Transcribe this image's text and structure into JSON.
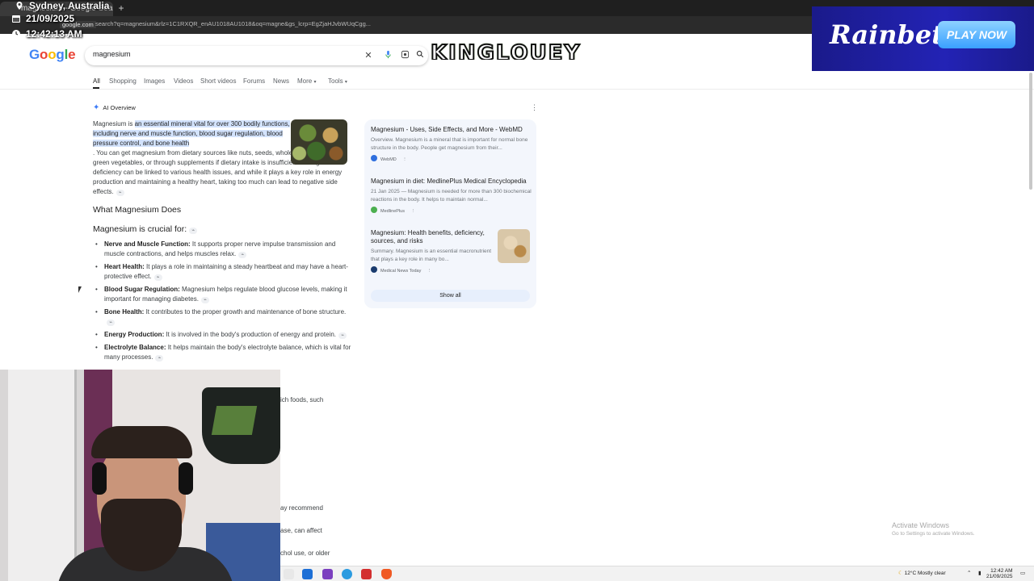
{
  "browser": {
    "tab_title": "magnesium - Google Search",
    "new_tab_glyph": "+",
    "url_tooltip": "google.com",
    "url": "search?q=magnesium&rlz=1C1RXQR_enAU1018AU1018&oq=magne&gs_lcrp=EgZjaHJvbWUqCgg..."
  },
  "stream_overlay": {
    "location": "Sydney, Australia",
    "date": "21/09/2025",
    "time": "12:42:13 AM"
  },
  "promo": {
    "brand": "Rainbet",
    "cta": "PLAY NOW"
  },
  "banner": {
    "text": "KINGLOUEY"
  },
  "google": {
    "logo_letters": [
      "G",
      "o",
      "o",
      "g",
      "l",
      "e"
    ],
    "logo_colors": [
      "#4285F4",
      "#EA4335",
      "#FBBC05",
      "#4285F4",
      "#34A853",
      "#EA4335"
    ],
    "query": "magnesium",
    "tabs": [
      "All",
      "Shopping",
      "Images",
      "Videos",
      "Short videos",
      "Forums",
      "News",
      "More",
      "Tools"
    ]
  },
  "ai_overview": {
    "label": "AI Overview",
    "intro_plain": "Magnesium is ",
    "intro_highlight": "an essential mineral vital for over 300 bodily functions, including nerve and muscle function, blood sugar regulation, blood pressure control, and bone health",
    "intro_rest": ". You can get magnesium from dietary sources like nuts, seeds, whole grains, and leafy green vegetables, or through supplements if dietary intake is insufficient. A magnesium deficiency can be linked to various health issues, and while it plays a key role in energy production and maintaining a healthy heart, taking too much can lead to negative side effects.",
    "heading": "What Magnesium Does",
    "subheading": "Magnesium is crucial for:",
    "bullets": [
      {
        "title": "Nerve and Muscle Function:",
        "text": " It supports proper nerve impulse transmission and muscle contractions, and helps muscles relax."
      },
      {
        "title": "Heart Health:",
        "text": " It plays a role in maintaining a steady heartbeat and may have a heart-protective effect."
      },
      {
        "title": "Blood Sugar Regulation:",
        "text": " Magnesium helps regulate blood glucose levels, making it important for managing diabetes."
      },
      {
        "title": "Bone Health:",
        "text": " It contributes to the proper growth and maintenance of bone structure."
      },
      {
        "title": "Energy Production:",
        "text": " It is involved in the body's production of energy and protein."
      },
      {
        "title": "Electrolyte Balance:",
        "text": " It helps maintain the body's electrolyte balance, which is vital for many processes."
      }
    ],
    "cut_lines": [
      "ich foods, such",
      "ay recommend",
      "ase, can affect",
      "chol use, or older"
    ]
  },
  "sources": {
    "items": [
      {
        "title": "Magnesium - Uses, Side Effects, and More - WebMD",
        "snippet": "Overview. Magnesium is a mineral that is important for normal bone structure in the body. People get magnesium from their...",
        "site": "WebMD",
        "fav_color": "#2f6fde"
      },
      {
        "title": "Magnesium in diet: MedlinePlus Medical Encyclopedia",
        "snippet": "21 Jan 2025 — Magnesium is needed for more than 300 biochemical reactions in the body. It helps to maintain normal...",
        "site": "MedlinePlus",
        "fav_color": "#4caf50"
      },
      {
        "title": "Magnesium: Health benefits, deficiency, sources, and risks",
        "snippet": "Summary. Magnesium is an essential macronutrient that plays a key role in many bo...",
        "site": "Medical News Today",
        "fav_color": "#1a3b6e"
      }
    ],
    "show_all": "Show all"
  },
  "system": {
    "activate_title": "Activate Windows",
    "activate_sub": "Go to Settings to activate Windows.",
    "weather": "12°C  Mostly clear",
    "clock_time": "12:42 AM",
    "clock_date": "21/09/2025"
  }
}
